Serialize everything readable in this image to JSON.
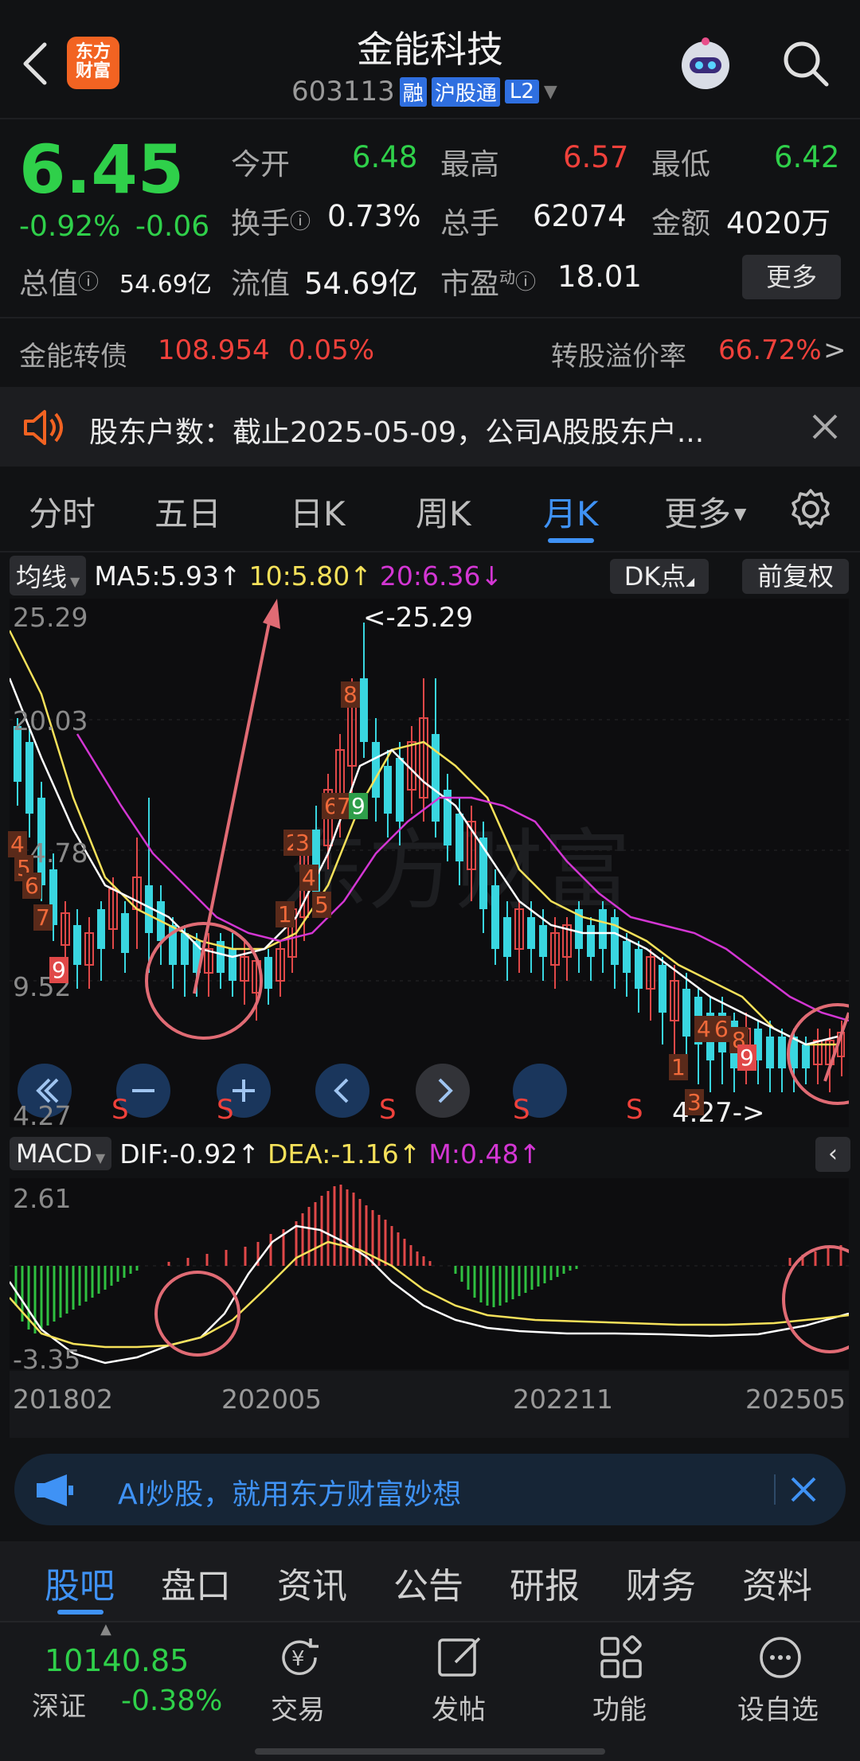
{
  "header": {
    "title": "金能科技",
    "code": "603113",
    "badge_rong": "融",
    "badge_hgt": "沪股通",
    "badge_l2": "L2",
    "logo_text_1": "东方",
    "logo_text_2": "财富"
  },
  "quote": {
    "price": "6.45",
    "change_pct": "-0.92%",
    "change": "-0.06",
    "open_label": "今开",
    "open": "6.48",
    "high_label": "最高",
    "high": "6.57",
    "low_label": "最低",
    "low": "6.42",
    "turnover_label": "换手",
    "turnover": "0.73%",
    "volume_label": "总手",
    "volume": "62074",
    "amount_label": "金额",
    "amount": "4020万",
    "mktcap_label": "总值",
    "mktcap": "54.69亿",
    "float_label": "流值",
    "float": "54.69亿",
    "pe_label": "市盈",
    "pe_sup": "动",
    "pe": "18.01",
    "more_button": "更多"
  },
  "bond": {
    "name": "金能转债",
    "price": "108.954",
    "pct": "0.05%",
    "premium_label": "转股溢价率",
    "premium": "66.72%",
    "arrow": ">"
  },
  "notice": {
    "text": "股东户数：截止2025-05-09，公司A股股东户..."
  },
  "tabs": [
    "分时",
    "五日",
    "日K",
    "周K",
    "月K",
    "更多"
  ],
  "active_tab": "月K",
  "ma_bar": {
    "selector": "均线",
    "ma5": "MA5:5.93",
    "ma10": "10:5.80",
    "ma20": "20:6.36",
    "dk_button": "DK点",
    "fq_button": "前复权"
  },
  "kchart": {
    "y_labels": [
      "25.29",
      "20.03",
      "14.78",
      "9.52",
      "4.27"
    ],
    "max_label": "<-25.29",
    "min_label": "4.27->",
    "s_marks": [
      "S",
      "S",
      "S",
      "S",
      "S"
    ],
    "td_digits": [
      "4",
      "5",
      "6",
      "7",
      "9",
      "8",
      "2",
      "3",
      "4",
      "5",
      "1",
      "6",
      "7",
      "9",
      "1",
      "2",
      "3",
      "4",
      "6",
      "8",
      "9"
    ]
  },
  "macd": {
    "selector": "MACD",
    "dif": "DIF:-0.92",
    "dea": "DEA:-1.16",
    "m": "M:0.48",
    "y_top": "2.61",
    "y_bottom": "-3.35",
    "x_labels": [
      "201802",
      "202005",
      "202211",
      "202505"
    ]
  },
  "ai_banner": {
    "text": "AI炒股，就用东方财富妙想"
  },
  "bottom_tabs": [
    "股吧",
    "盘口",
    "资讯",
    "公告",
    "研报",
    "财务",
    "资料"
  ],
  "active_bottom_tab": "股吧",
  "footer": {
    "index_value": "10140.85",
    "index_name": "深证",
    "index_pct": "-0.38%",
    "actions": [
      "交易",
      "发帖",
      "功能",
      "设自选"
    ]
  },
  "colors": {
    "up": "#f0413b",
    "down": "#2fd04a",
    "accent": "#2e8cf0",
    "ma5": "#ffffff",
    "ma10": "#f5e15a",
    "ma20": "#d336d3"
  }
}
